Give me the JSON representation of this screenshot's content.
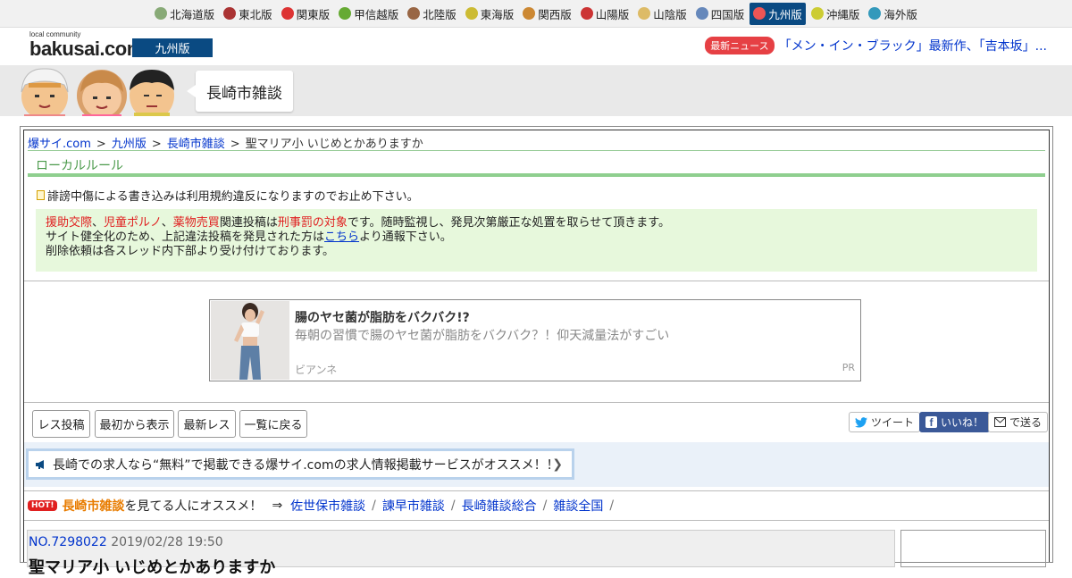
{
  "regions": [
    {
      "label": "北海道版",
      "icon": "sheep-icon",
      "color": "#8a7"
    },
    {
      "label": "東北版",
      "icon": "namahage-icon",
      "color": "#a33"
    },
    {
      "label": "関東版",
      "icon": "tower-icon",
      "color": "#d33"
    },
    {
      "label": "甲信越版",
      "icon": "grape-icon",
      "color": "#6a3"
    },
    {
      "label": "北陸版",
      "icon": "gate-icon",
      "color": "#964"
    },
    {
      "label": "東海版",
      "icon": "shachihoko-icon",
      "color": "#cb3"
    },
    {
      "label": "関西版",
      "icon": "takoyaki-icon",
      "color": "#c83"
    },
    {
      "label": "山陽版",
      "icon": "shrine-icon",
      "color": "#c33"
    },
    {
      "label": "山陰版",
      "icon": "crab-icon",
      "color": "#db6"
    },
    {
      "label": "四国版",
      "icon": "udon-icon",
      "color": "#68b"
    },
    {
      "label": "九州版",
      "icon": "fish-icon",
      "color": "#e55",
      "active": true
    },
    {
      "label": "沖縄版",
      "icon": "shisa-icon",
      "color": "#cc3"
    },
    {
      "label": "海外版",
      "icon": "globe-icon",
      "color": "#39b"
    }
  ],
  "logo": {
    "small": "local community",
    "big": "bakusai.com"
  },
  "edition": "九州版",
  "news": {
    "badge": "最新ニュース",
    "text": "「メン・イン・ブラック」最新作、「吉本坂」..."
  },
  "category": "長崎市雑談",
  "breadcrumb": {
    "home": "爆サイ.com",
    "region": "九州版",
    "board": "長崎市雑談",
    "current": "聖マリア小 いじめとかありますか",
    "sep": ">"
  },
  "local_rule": {
    "heading": "ローカルルール",
    "warning": "誹謗中傷による書き込みは利用規約違反になりますのでお止め下さい。",
    "line1_parts": [
      "援助交際",
      "、",
      "児童ポルノ",
      "、",
      "薬物売買",
      "関連投稿は",
      "刑事罰の対象",
      "です。随時監視し、発見次第厳正な処置を取らせて頂きます。"
    ],
    "line2_pre": "サイト健全化のため、上記違法投稿を発見された方は",
    "line2_link": "こちら",
    "line2_post": "より通報下さい。",
    "line3": "削除依頼は各スレッド内下部より受け付けております。"
  },
  "ad": {
    "title": "腸のヤセ菌が脂肪をバクバク!?",
    "desc": "毎朝の習慣で腸のヤセ菌が脂肪をバクバク？！仰天減量法がすごい",
    "source": "ビアンネ",
    "pr": "PR"
  },
  "toolbar": {
    "post": "レス投稿",
    "from_start": "最初から表示",
    "latest": "最新レス",
    "back": "一覧に戻る",
    "tweet": "ツイート",
    "like": "いいね！",
    "send": "で送る"
  },
  "job_banner": "長崎での求人なら“無料”で掲載できる爆サイ.comの求人情報掲載サービスがオススメ！！",
  "recommend": {
    "hot": "HOT!",
    "board": "長崎市雑談",
    "text": "を見てる人にオススメ！",
    "arrow": "⇒",
    "links": [
      "佐世保市雑談",
      "諫早市雑談",
      "長崎雑談総合",
      "雑談全国"
    ],
    "sep": "/"
  },
  "post": {
    "no": "NO.7298022",
    "date": "2019/02/28 19:50",
    "title": "聖マリア小 いじめとかありますか"
  }
}
